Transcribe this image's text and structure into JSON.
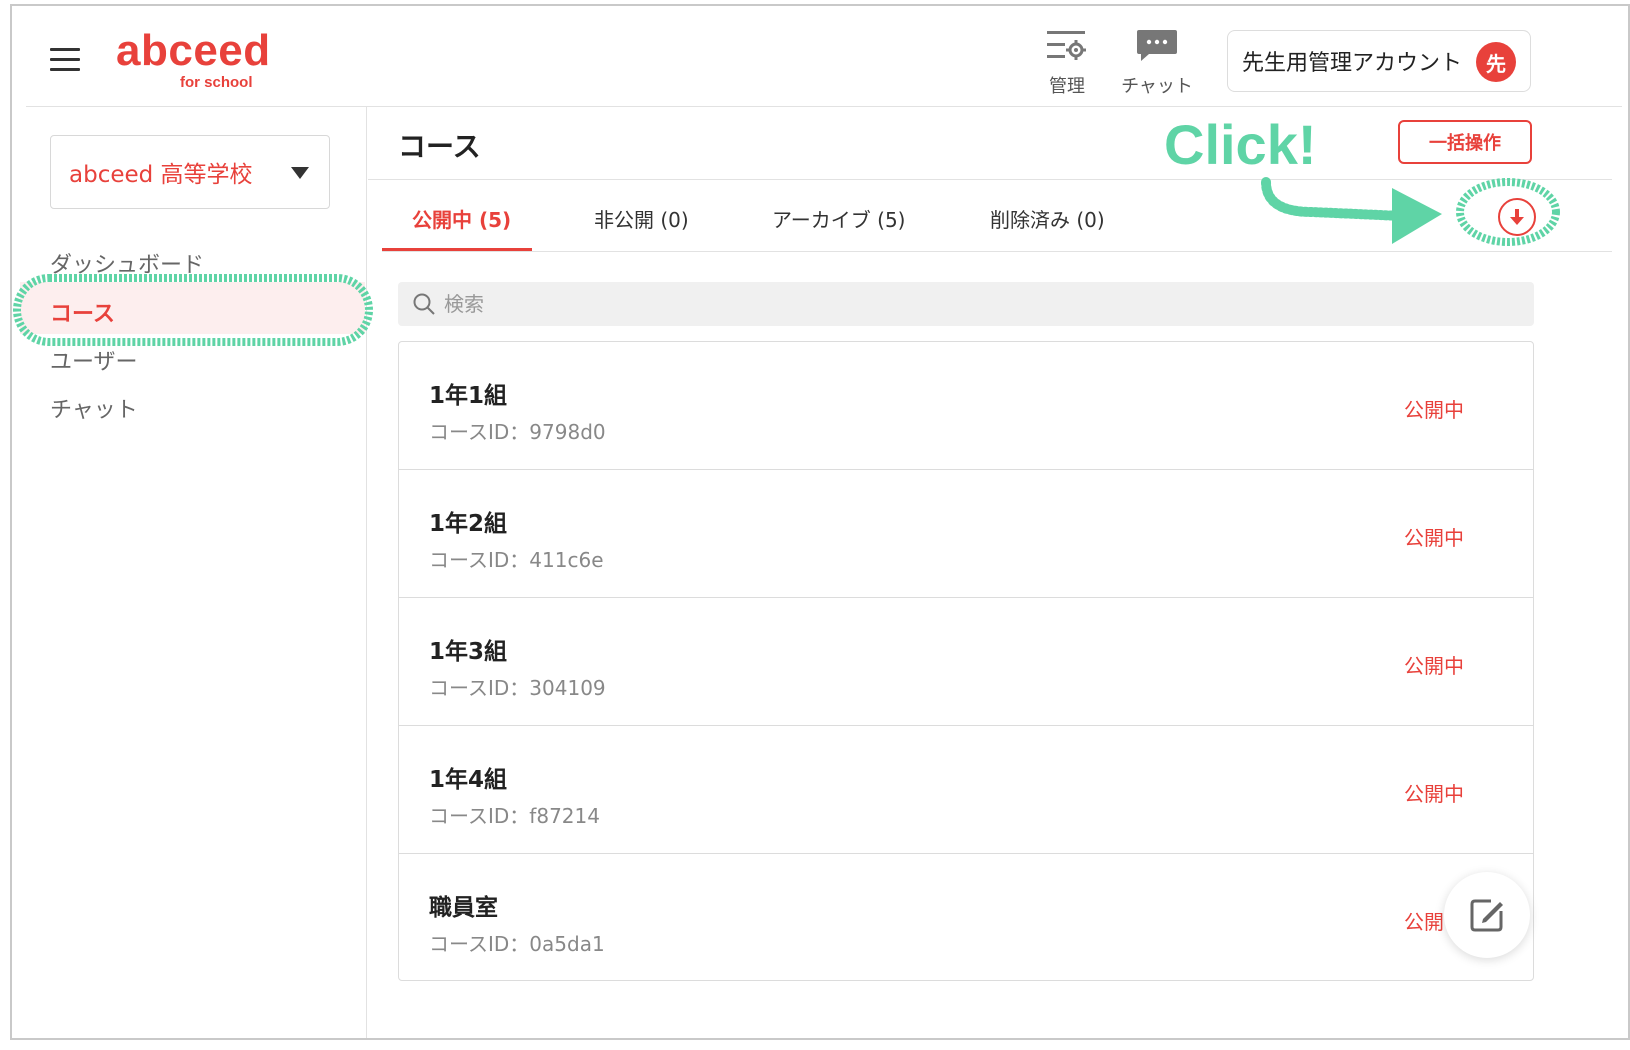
{
  "header": {
    "logo_main": "abceed",
    "logo_sub": "for school",
    "manage_label": "管理",
    "chat_label": "チャット",
    "account_name": "先生用管理アカウント",
    "avatar_char": "先"
  },
  "sidebar": {
    "school_select": "abceed 高等学校",
    "items": [
      {
        "label": "ダッシュボード"
      },
      {
        "label": "コース"
      },
      {
        "label": "ユーザー"
      },
      {
        "label": "チャット"
      }
    ]
  },
  "main": {
    "title": "コース",
    "bulk_button": "一括操作",
    "tabs": [
      {
        "label": "公開中 (5)"
      },
      {
        "label": "非公開 (0)"
      },
      {
        "label": "アーカイブ (5)"
      },
      {
        "label": "削除済み (0)"
      }
    ],
    "search_placeholder": "検索",
    "courses": [
      {
        "name": "1年1組",
        "id": "コースID：9798d0",
        "status": "公開中"
      },
      {
        "name": "1年2組",
        "id": "コースID：411c6e",
        "status": "公開中"
      },
      {
        "name": "1年3組",
        "id": "コースID：304109",
        "status": "公開中"
      },
      {
        "name": "1年4組",
        "id": "コースID：f87214",
        "status": "公開中"
      },
      {
        "name": "職員室",
        "id": "コースID：0a5da1",
        "status": "公開"
      }
    ]
  },
  "annotation": {
    "click_text": "Click!"
  },
  "colors": {
    "brand": "#e8413b",
    "annotation": "#5fd4a6"
  }
}
